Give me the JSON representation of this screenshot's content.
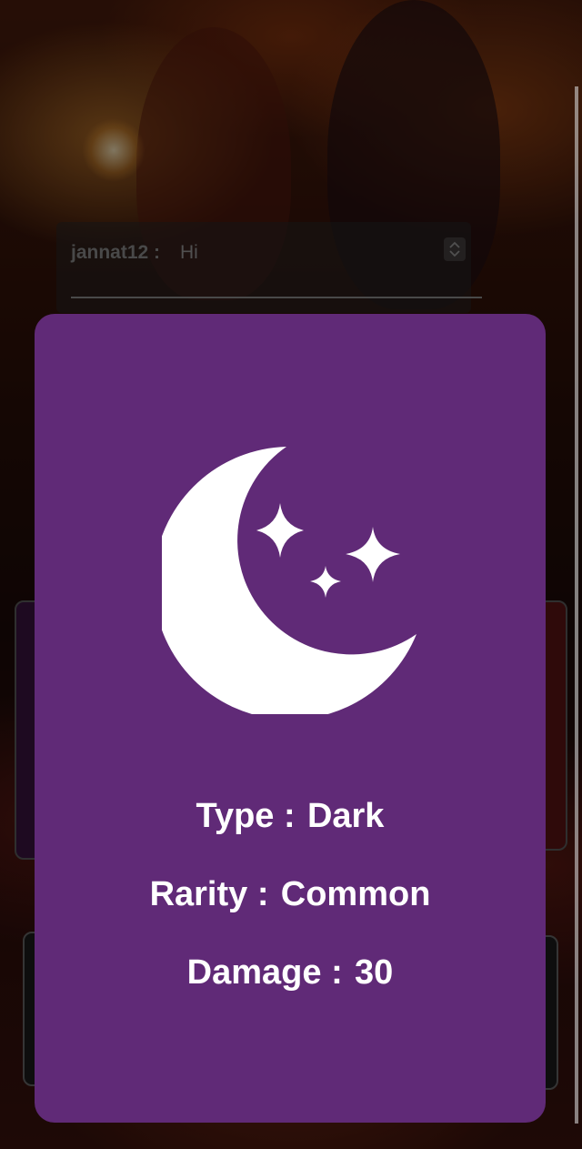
{
  "chat": {
    "username": "jannat12 :",
    "message": "Hi"
  },
  "card": {
    "icon": "crescent-moon-with-stars",
    "background_color": "#602a77",
    "stats": [
      {
        "label": "Type :",
        "value": "Dark"
      },
      {
        "label": "Rarity :",
        "value": "Common"
      },
      {
        "label": "Damage :",
        "value": "30"
      }
    ]
  }
}
